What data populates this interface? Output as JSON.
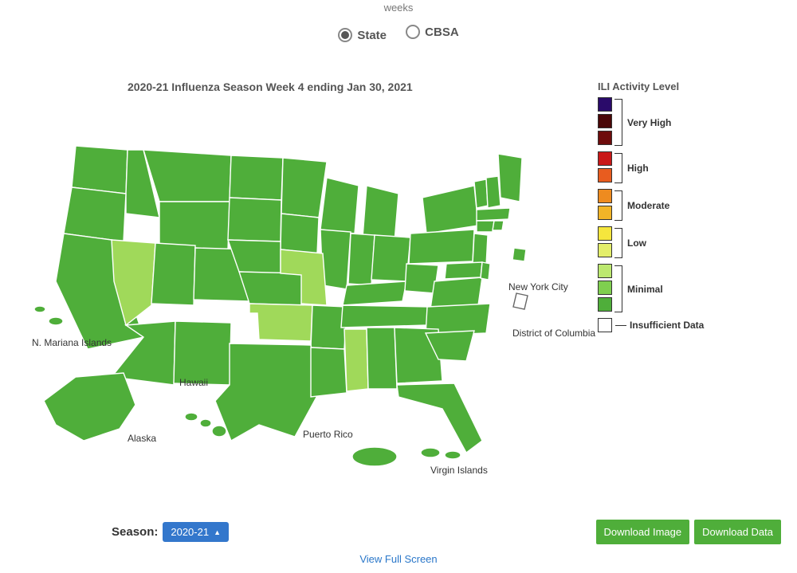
{
  "header": {
    "truncated_label": "weeks",
    "radios": {
      "state": "State",
      "cbsa": "CBSA",
      "selected": "state"
    }
  },
  "map": {
    "title": "2020-21 Influenza Season Week 4 ending Jan 30, 2021",
    "labels": {
      "nmi": "N. Mariana Islands",
      "hawaii": "Hawaii",
      "alaska": "Alaska",
      "pr": "Puerto Rico",
      "vi": "Virgin Islands",
      "nyc": "New York City",
      "dc": "District of Columbia"
    },
    "lighter_states": [
      "Nevada",
      "Missouri",
      "Oklahoma",
      "Mississippi"
    ],
    "insufficient": [
      "District of Columbia"
    ]
  },
  "legend": {
    "title": "ILI Activity Level",
    "groups": [
      {
        "label": "Very High",
        "colors": [
          "#2a0a6a",
          "#4a0707",
          "#6e0c0c"
        ]
      },
      {
        "label": "High",
        "colors": [
          "#c91818",
          "#e85c1f"
        ]
      },
      {
        "label": "Moderate",
        "colors": [
          "#ee8b1f",
          "#f2b427"
        ]
      },
      {
        "label": "Low",
        "colors": [
          "#f5e63d",
          "#e3ee6a"
        ]
      },
      {
        "label": "Minimal",
        "colors": [
          "#bce86f",
          "#7fcf4f",
          "#4fae3a"
        ]
      }
    ],
    "insufficient": {
      "label": "Insufficient Data",
      "color": "#ffffff"
    }
  },
  "controls": {
    "season_label": "Season:",
    "season_value": "2020-21",
    "download_image": "Download Image",
    "download_data": "Download Data",
    "view_full": "View Full Screen"
  }
}
